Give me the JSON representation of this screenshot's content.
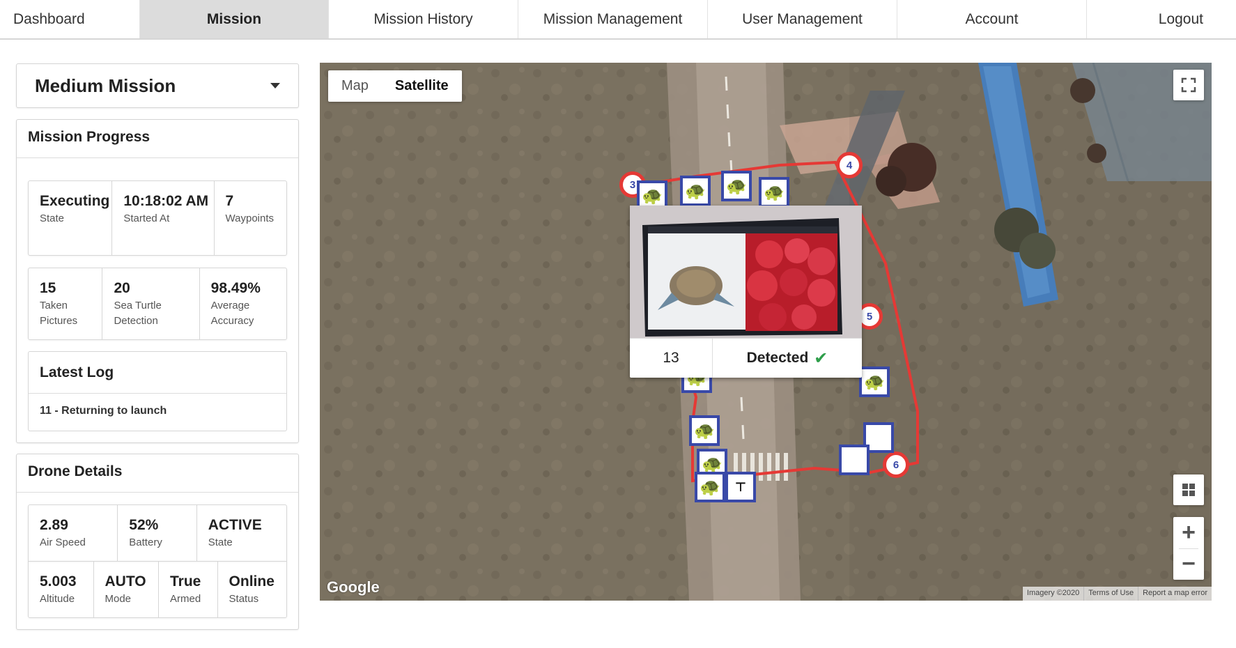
{
  "nav": {
    "items": [
      "Dashboard",
      "Mission",
      "Mission History",
      "Mission Management",
      "User Management",
      "Account",
      "Logout"
    ],
    "active": "Mission"
  },
  "mission_select": {
    "value": "Medium Mission"
  },
  "mission_progress": {
    "title": "Mission Progress",
    "row1": [
      {
        "value": "Executing",
        "label": "State"
      },
      {
        "value": "10:18:02 AM",
        "label": "Started At"
      },
      {
        "value": "7",
        "label": "Waypoints"
      }
    ],
    "row2": [
      {
        "value": "15",
        "label": "Taken Pictures"
      },
      {
        "value": "20",
        "label": "Sea Turtle Detection"
      },
      {
        "value": "98.49%",
        "label": "Average Accuracy"
      }
    ]
  },
  "latest_log": {
    "title": "Latest Log",
    "text": "11 - Returning to launch"
  },
  "drone_details": {
    "title": "Drone Details",
    "row1": [
      {
        "value": "2.89",
        "label": "Air Speed"
      },
      {
        "value": "52%",
        "label": "Battery"
      },
      {
        "value": "ACTIVE",
        "label": "State"
      }
    ],
    "row2": [
      {
        "value": "5.003",
        "label": "Altitude"
      },
      {
        "value": "AUTO",
        "label": "Mode"
      },
      {
        "value": "True",
        "label": "Armed"
      },
      {
        "value": "Online",
        "label": "Status"
      }
    ]
  },
  "map": {
    "tabs": [
      "Map",
      "Satellite"
    ],
    "active_tab": "Satellite",
    "logo": "Google",
    "attribution": [
      "Imagery ©2020",
      "Terms of Use",
      "Report a map error"
    ],
    "zoom_in": "+",
    "zoom_out": "−",
    "waypoints": [
      "3",
      "4",
      "5",
      "6"
    ],
    "popup": {
      "number": "13",
      "status": "Detected"
    },
    "colors": {
      "route": "#e53935",
      "marker_border": "#3949a8"
    }
  }
}
